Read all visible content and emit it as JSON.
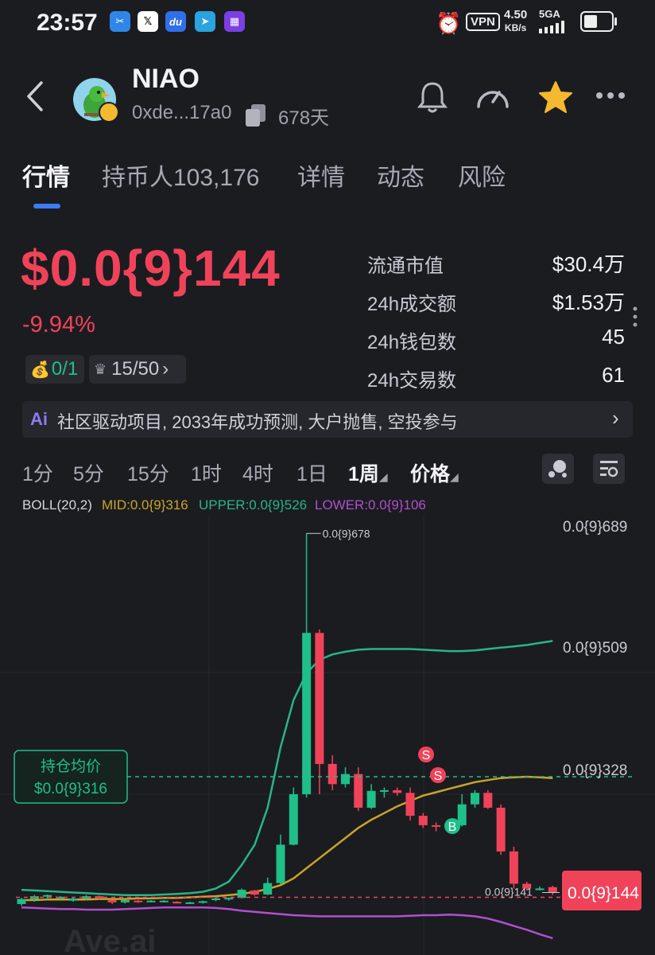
{
  "status_bar": {
    "time": "23:57",
    "vpn": "VPN",
    "speed_value": "4.50",
    "speed_unit": "KB/s",
    "network": "5GA"
  },
  "header": {
    "title": "NIAO",
    "address": "0xde...17a0",
    "age": "678天"
  },
  "tabs": [
    {
      "label": "行情"
    },
    {
      "label": "持币人103,176"
    },
    {
      "label": "详情"
    },
    {
      "label": "动态"
    },
    {
      "label": "风险"
    }
  ],
  "price": {
    "value": "$0.0{9}144",
    "change": "-9.94%",
    "badge1": "0/1",
    "badge2": "15/50"
  },
  "stats": [
    {
      "label": "流通市值",
      "value": "$30.4万"
    },
    {
      "label": "24h成交额",
      "value": "$1.53万"
    },
    {
      "label": "24h钱包数",
      "value": "45"
    },
    {
      "label": "24h交易数",
      "value": "61"
    }
  ],
  "ai_summary": "社区驱动项目, 2033年成功预测, 大户抛售, 空投参与",
  "intervals": [
    "1分",
    "5分",
    "15分",
    "1时",
    "4时",
    "1日",
    "1周",
    "价格"
  ],
  "boll": {
    "name": "BOLL(20,2)",
    "mid": "MID:0.0{9}316",
    "upper": "UPPER:0.0{9}526",
    "lower": "LOWER:0.0{9}106"
  },
  "chart": {
    "y_labels": [
      "0.0{9}689",
      "0.0{9}509",
      "0.0{9}328"
    ],
    "high_label": "0.0{9}678",
    "low_label": "0.0{9}141",
    "current_label": "0.0{9}144",
    "avg_cost_title": "持仓均价",
    "avg_cost_value": "$0.0{9}316",
    "watermark": "Ave.ai",
    "colors": {
      "up": "#1fbf8a",
      "down": "#f0435a",
      "mid": "#c9a42a",
      "upper": "#27b589",
      "lower": "#b24fd0"
    }
  },
  "chart_data": {
    "type": "candlestick",
    "candles": [
      [
        124,
        133,
        121,
        135
      ],
      [
        133,
        138,
        128,
        140
      ],
      [
        138,
        140,
        132,
        141
      ],
      [
        136,
        137,
        130,
        138
      ],
      [
        130,
        134,
        128,
        136
      ],
      [
        134,
        138,
        131,
        140
      ],
      [
        138,
        137,
        132,
        139
      ],
      [
        131,
        127,
        124,
        130
      ],
      [
        127,
        131,
        125,
        132
      ],
      [
        130,
        128,
        126,
        131
      ],
      [
        128,
        130,
        127,
        131
      ],
      [
        129,
        130,
        127,
        131
      ],
      [
        128,
        127,
        125,
        129
      ],
      [
        127,
        127,
        124,
        128
      ],
      [
        127,
        129,
        125,
        130
      ],
      [
        131,
        134,
        129,
        135
      ],
      [
        133,
        135,
        130,
        136
      ],
      [
        135,
        148,
        134,
        150
      ],
      [
        147,
        141,
        139,
        148
      ],
      [
        141,
        158,
        140,
        166
      ],
      [
        158,
        215,
        156,
        230
      ],
      [
        215,
        290,
        214,
        300
      ],
      [
        290,
        530,
        285,
        678
      ],
      [
        530,
        335,
        290,
        535
      ],
      [
        335,
        305,
        296,
        348
      ],
      [
        305,
        320,
        300,
        330
      ],
      [
        320,
        270,
        265,
        330
      ],
      [
        270,
        295,
        268,
        305
      ],
      [
        295,
        296,
        285,
        300
      ],
      [
        296,
        292,
        288,
        300
      ],
      [
        292,
        258,
        251,
        300
      ],
      [
        258,
        244,
        240,
        262
      ],
      [
        244,
        242,
        235,
        248
      ],
      [
        242,
        244,
        239,
        246
      ],
      [
        244,
        275,
        242,
        290
      ],
      [
        275,
        292,
        270,
        296
      ],
      [
        292,
        270,
        268,
        296
      ],
      [
        270,
        205,
        200,
        275
      ],
      [
        205,
        157,
        150,
        212
      ],
      [
        157,
        150,
        147,
        160
      ],
      [
        150,
        150,
        147,
        153
      ],
      [
        152,
        144,
        140,
        154
      ]
    ],
    "mid": [
      131,
      131,
      132,
      132,
      132,
      132,
      133,
      133,
      133,
      134,
      134,
      135,
      135,
      136,
      137,
      138,
      140,
      142,
      145,
      149,
      155,
      165,
      180,
      195,
      210,
      225,
      240,
      252,
      262,
      272,
      280,
      288,
      293,
      298,
      303,
      308,
      311,
      314,
      315,
      316,
      315,
      314
    ],
    "upper": [
      148,
      147,
      146,
      145,
      144,
      143,
      142,
      141,
      140,
      140,
      140,
      141,
      142,
      143,
      145,
      150,
      160,
      185,
      215,
      270,
      360,
      430,
      470,
      490,
      498,
      502,
      505,
      506,
      506,
      506,
      506,
      505,
      504,
      503,
      503,
      504,
      506,
      508,
      510,
      512,
      515,
      518
    ],
    "lower": [
      118,
      117,
      116,
      115,
      115,
      114,
      114,
      114,
      115,
      116,
      117,
      118,
      118,
      118,
      118,
      117,
      115,
      112,
      110,
      108,
      106,
      104,
      103,
      102,
      102,
      102,
      102,
      102,
      102,
      102,
      103,
      104,
      104,
      105,
      104,
      102,
      98,
      92,
      85,
      78,
      70,
      63
    ],
    "avg_cost": 316,
    "current": 144,
    "ylim": [
      50,
      700
    ]
  }
}
